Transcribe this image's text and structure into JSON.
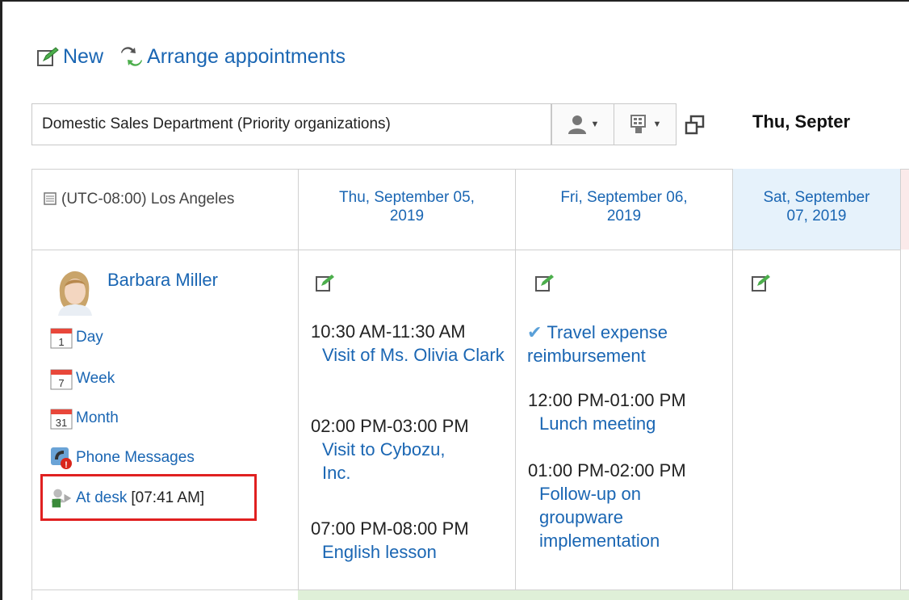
{
  "toolbar": {
    "new_label": "New",
    "arrange_label": "Arrange appointments"
  },
  "selector": {
    "organization": "Domestic Sales Department (Priority organizations)"
  },
  "date_heading": "Thu, Septer",
  "grid": {
    "timezone": "(UTC-08:00) Los Angeles",
    "days": [
      {
        "label": "Thu, September 05, 2019",
        "line1": "Thu, September 05,",
        "line2": "2019"
      },
      {
        "label": "Fri, September 06, 2019",
        "line1": "Fri, September 06,",
        "line2": "2019"
      },
      {
        "label": "Sat, September 07, 2019",
        "line1": "Sat, September",
        "line2": "07, 2019"
      }
    ]
  },
  "user": {
    "name": "Barbara Miller",
    "links": {
      "day": "Day",
      "week": "Week",
      "month": "Month",
      "phone": "Phone Messages"
    },
    "status": {
      "label": "At desk",
      "time": "[07:41 AM]"
    }
  },
  "appointments": {
    "thu": [
      {
        "time": "10:30 AM-11:30 AM",
        "title": "Visit of Ms. Olivia Clark"
      },
      {
        "time": "02:00 PM-03:00 PM",
        "title": "Visit to Cybozu, Inc."
      },
      {
        "time": "07:00 PM-08:00 PM",
        "title": "English lesson"
      }
    ],
    "fri_todo": {
      "title": "Travel expense reimbursement"
    },
    "fri": [
      {
        "time": "12:00 PM-01:00 PM",
        "title": "Lunch meeting"
      },
      {
        "time": "01:00 PM-02:00 PM",
        "title": "Follow-up on groupware implementation"
      }
    ]
  },
  "icons": {
    "new": "new-appointment-icon",
    "arrange": "arrange-icon",
    "accent": "#1a66b3",
    "highlight": "#e02020"
  }
}
